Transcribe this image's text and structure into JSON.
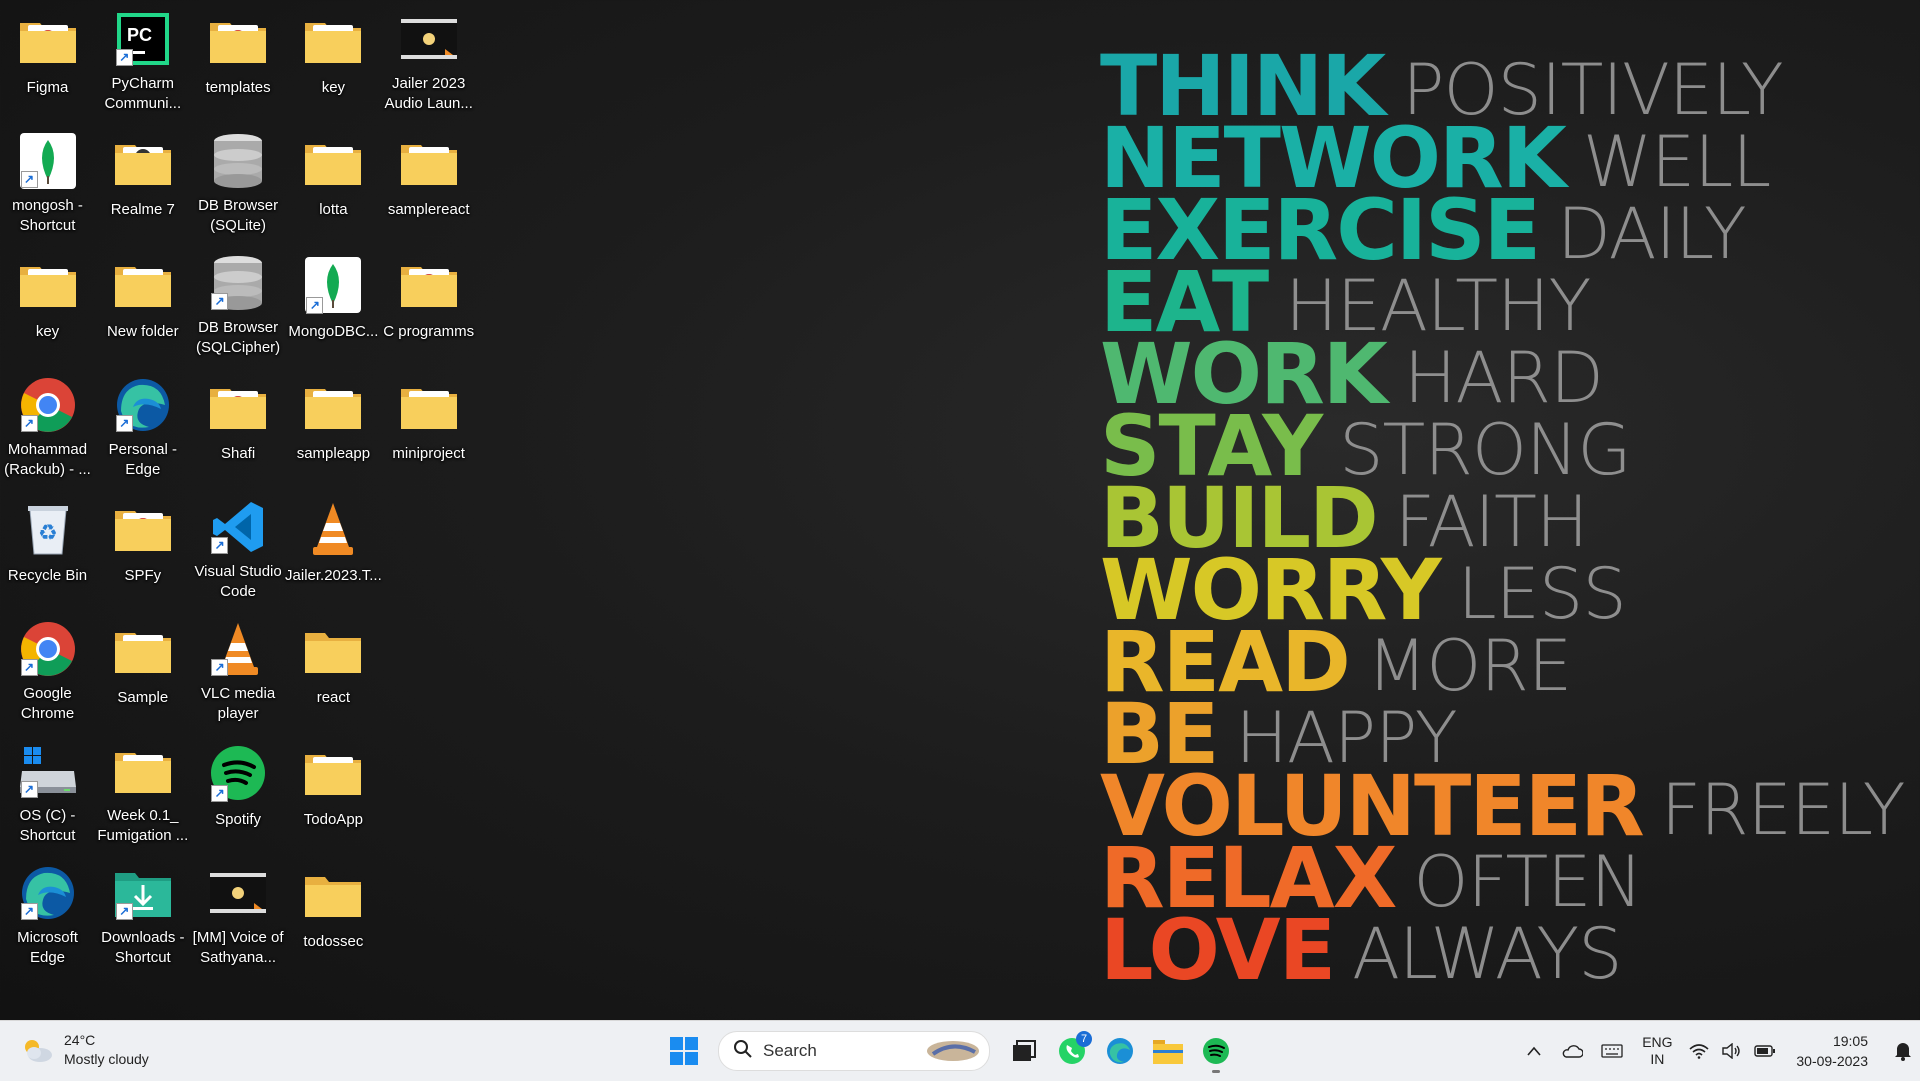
{
  "desktop": {
    "icons": [
      {
        "label": "Figma",
        "col": 0,
        "row": 0,
        "type": "folder-edge",
        "shortcut": false
      },
      {
        "label": "PyCharm Communi...",
        "col": 1,
        "row": 0,
        "type": "pycharm",
        "shortcut": true
      },
      {
        "label": "templates",
        "col": 2,
        "row": 0,
        "type": "folder-edge",
        "shortcut": false
      },
      {
        "label": "key",
        "col": 3,
        "row": 0,
        "type": "folder",
        "shortcut": false
      },
      {
        "label": "Jailer 2023 Audio Laun...",
        "col": 4,
        "row": 0,
        "type": "video",
        "shortcut": false
      },
      {
        "label": "mongosh - Shortcut",
        "col": 0,
        "row": 1,
        "type": "mongo",
        "shortcut": true
      },
      {
        "label": "Realme 7",
        "col": 1,
        "row": 1,
        "type": "folder-phone",
        "shortcut": false
      },
      {
        "label": "DB Browser (SQLite)",
        "col": 2,
        "row": 1,
        "type": "db",
        "shortcut": false
      },
      {
        "label": "lotta",
        "col": 3,
        "row": 1,
        "type": "folder",
        "shortcut": false
      },
      {
        "label": "samplereact",
        "col": 4,
        "row": 1,
        "type": "folder",
        "shortcut": false
      },
      {
        "label": "key",
        "col": 0,
        "row": 2,
        "type": "folder",
        "shortcut": false
      },
      {
        "label": "New folder",
        "col": 1,
        "row": 2,
        "type": "folder",
        "shortcut": false
      },
      {
        "label": "DB Browser (SQLCipher)",
        "col": 2,
        "row": 2,
        "type": "db",
        "shortcut": true
      },
      {
        "label": "MongoDBC...",
        "col": 3,
        "row": 2,
        "type": "mongo",
        "shortcut": true
      },
      {
        "label": "C programms",
        "col": 4,
        "row": 2,
        "type": "folder-edge",
        "shortcut": false
      },
      {
        "label": "Mohammad (Rackub) - ...",
        "col": 0,
        "row": 3,
        "type": "chrome",
        "shortcut": true
      },
      {
        "label": "Personal - Edge",
        "col": 1,
        "row": 3,
        "type": "edge",
        "shortcut": true
      },
      {
        "label": "Shafi",
        "col": 2,
        "row": 3,
        "type": "folder-edge",
        "shortcut": false
      },
      {
        "label": "sampleapp",
        "col": 3,
        "row": 3,
        "type": "folder",
        "shortcut": false
      },
      {
        "label": "miniproject",
        "col": 4,
        "row": 3,
        "type": "folder",
        "shortcut": false
      },
      {
        "label": "Recycle Bin",
        "col": 0,
        "row": 4,
        "type": "recycle",
        "shortcut": false
      },
      {
        "label": "SPFy",
        "col": 1,
        "row": 4,
        "type": "folder-edge",
        "shortcut": false
      },
      {
        "label": "Visual Studio Code",
        "col": 2,
        "row": 4,
        "type": "vscode",
        "shortcut": true
      },
      {
        "label": "Jailer.2023.T...",
        "col": 3,
        "row": 4,
        "type": "vlc",
        "shortcut": false
      },
      {
        "label": "Google Chrome",
        "col": 0,
        "row": 5,
        "type": "chrome",
        "shortcut": true
      },
      {
        "label": "Sample",
        "col": 1,
        "row": 5,
        "type": "folder",
        "shortcut": false
      },
      {
        "label": "VLC media player",
        "col": 2,
        "row": 5,
        "type": "vlc",
        "shortcut": true
      },
      {
        "label": "react",
        "col": 3,
        "row": 5,
        "type": "folder-plain",
        "shortcut": false
      },
      {
        "label": "OS (C) - Shortcut",
        "col": 0,
        "row": 6,
        "type": "drive",
        "shortcut": true
      },
      {
        "label": "Week 0.1_ Fumigation ...",
        "col": 1,
        "row": 6,
        "type": "folder",
        "shortcut": false
      },
      {
        "label": "Spotify",
        "col": 2,
        "row": 6,
        "type": "spotify",
        "shortcut": true
      },
      {
        "label": "TodoApp",
        "col": 3,
        "row": 6,
        "type": "folder",
        "shortcut": false
      },
      {
        "label": "Microsoft Edge",
        "col": 0,
        "row": 7,
        "type": "edge",
        "shortcut": true
      },
      {
        "label": "Downloads - Shortcut",
        "col": 1,
        "row": 7,
        "type": "downloads",
        "shortcut": true
      },
      {
        "label": "[MM] Voice of Sathyana...",
        "col": 2,
        "row": 7,
        "type": "video",
        "shortcut": false
      },
      {
        "label": "todossec",
        "col": 3,
        "row": 7,
        "type": "folder-plain",
        "shortcut": false
      }
    ]
  },
  "wallpaper": {
    "lines": [
      {
        "bold": "THINK",
        "thin": "POSITIVELY",
        "color": "#1aa7a8"
      },
      {
        "bold": "NETWORK",
        "thin": "WELL",
        "color": "#1ab0a6"
      },
      {
        "bold": "EXERCISE",
        "thin": "DAILY",
        "color": "#18b29a"
      },
      {
        "bold": "EAT",
        "thin": "HEALTHY",
        "color": "#1db48c"
      },
      {
        "bold": "WORK",
        "thin": "HARD",
        "color": "#4fb870"
      },
      {
        "bold": "STAY",
        "thin": "STRONG",
        "color": "#79bd4b"
      },
      {
        "bold": "BUILD",
        "thin": "FAITH",
        "color": "#a9c534"
      },
      {
        "bold": "WORRY",
        "thin": "LESS",
        "color": "#d7c826"
      },
      {
        "bold": "READ",
        "thin": "MORE",
        "color": "#e9b62a"
      },
      {
        "bold": "BE",
        "thin": "HAPPY",
        "color": "#eca12b"
      },
      {
        "bold": "VOLUNTEER",
        "thin": "FREELY",
        "color": "#f0862a"
      },
      {
        "bold": "RELAX",
        "thin": "OFTEN",
        "color": "#ef6a28"
      },
      {
        "bold": "LOVE",
        "thin": "ALWAYS",
        "color": "#ea4724"
      }
    ]
  },
  "taskbar": {
    "weather": {
      "temp": "24°C",
      "condition": "Mostly cloudy"
    },
    "search": {
      "placeholder": "Search"
    },
    "whatsapp_badge": "7",
    "language": {
      "lang": "ENG",
      "region": "IN"
    },
    "clock": {
      "time": "19:05",
      "date": "30-09-2023"
    }
  }
}
